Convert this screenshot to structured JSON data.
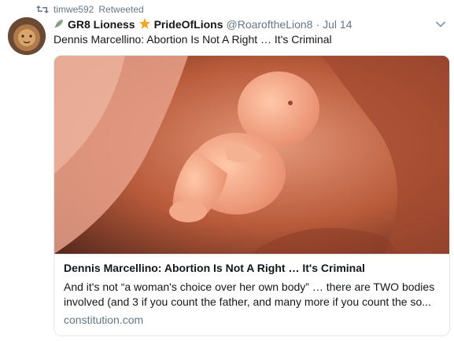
{
  "retweet": {
    "icon": "retweet-icon",
    "user": "timwe592",
    "label": "Retweeted"
  },
  "tweet": {
    "avatar_icon": "avatar-image",
    "display_name_part1": "GR8 Lioness",
    "display_name_part2": "PrideOfLions",
    "handle": "@RoaroftheLion8",
    "separator": "·",
    "time": "Jul 14",
    "text": "Dennis Marcellino: Abortion Is Not A Right … It's Criminal",
    "menu_icon": "chevron-down-icon"
  },
  "card": {
    "image_icon": "fetus-model-in-hands-image",
    "title": "Dennis Marcellino: Abortion Is Not A Right … It's Criminal",
    "description": "And it's not “a woman's choice over her own body” … there are TWO bodies involved (and 3 if you count the father, and many more if you count the so...",
    "domain": "constitution.com"
  },
  "colors": {
    "text_primary": "#14171a",
    "text_secondary": "#657786",
    "border": "#e1e8ed",
    "star": "#f5a623",
    "leaf": "#8fa88b"
  }
}
